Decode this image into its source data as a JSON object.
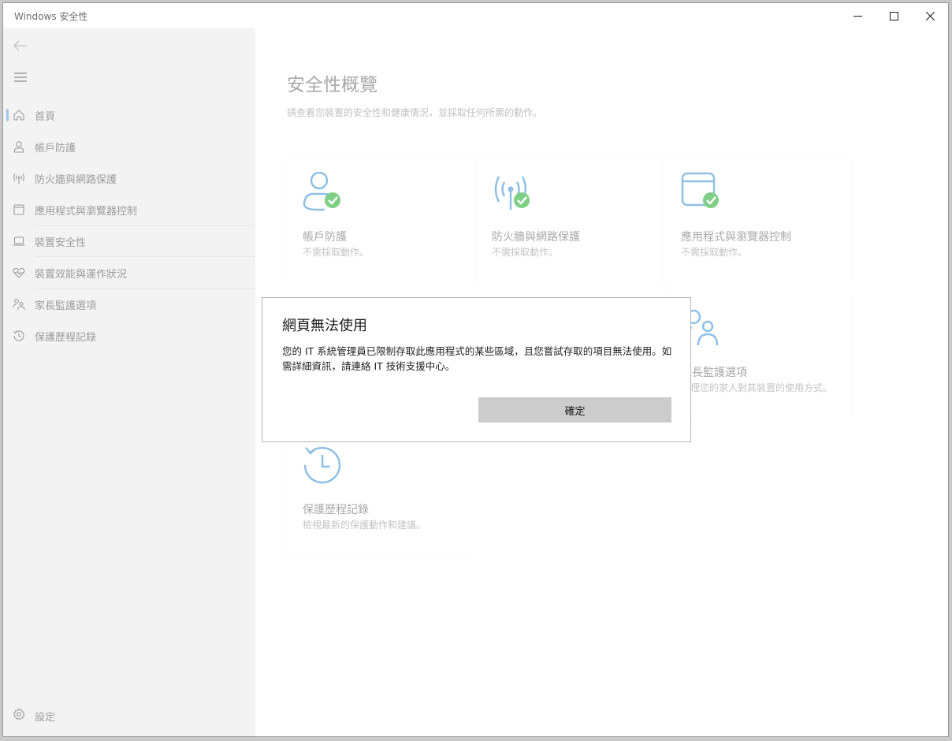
{
  "window": {
    "title": "Windows 安全性"
  },
  "sidebar": {
    "items": [
      {
        "label": "首頁",
        "icon": "home-icon",
        "active": true
      },
      {
        "label": "帳戶防護",
        "icon": "person-icon"
      },
      {
        "label": "防火牆與網路保護",
        "icon": "antenna-icon"
      },
      {
        "label": "應用程式與瀏覽器控制",
        "icon": "browser-window-icon"
      },
      {
        "label": "裝置安全性",
        "icon": "laptop-icon"
      },
      {
        "label": "裝置效能與運作狀況",
        "icon": "heart-pulse-icon"
      },
      {
        "label": "家長監護選項",
        "icon": "family-icon"
      },
      {
        "label": "保護歷程記錄",
        "icon": "history-icon"
      }
    ],
    "settings_label": "設定"
  },
  "main": {
    "title": "安全性概覽",
    "subtitle": "請查看您裝置的安全性和健康情況，並採取任何所需的動作。",
    "tiles": [
      {
        "name": "帳戶防護",
        "desc": "不需採取動作。",
        "icon": "account-check-icon"
      },
      {
        "name": "防火牆與網路保護",
        "desc": "不需採取動作。",
        "icon": "antenna-check-icon"
      },
      {
        "name": "應用程式與瀏覽器控制",
        "desc": "不需採取動作。",
        "icon": "browser-check-icon"
      },
      {
        "name": "家長監護選項",
        "desc": "管理您的家人對其裝置的使用方式。",
        "icon": "family-icon"
      },
      {
        "name": "保護歷程記錄",
        "desc": "檢視最新的保護動作和建議。",
        "icon": "history-icon"
      }
    ]
  },
  "dialog": {
    "title": "網頁無法使用",
    "body": "您的 IT 系統管理員已限制存取此應用程式的某些區域，且您嘗試存取的項目無法使用。如需詳細資訊，請連絡 IT 技術支援中心。",
    "ok_label": "確定"
  },
  "colors": {
    "accent": "#9ec7e6",
    "icon_blue": "#8fc0e6",
    "check_green": "#7fcf86",
    "button_gray": "#cccccc",
    "sidebar_bg": "#f3f3f3"
  }
}
